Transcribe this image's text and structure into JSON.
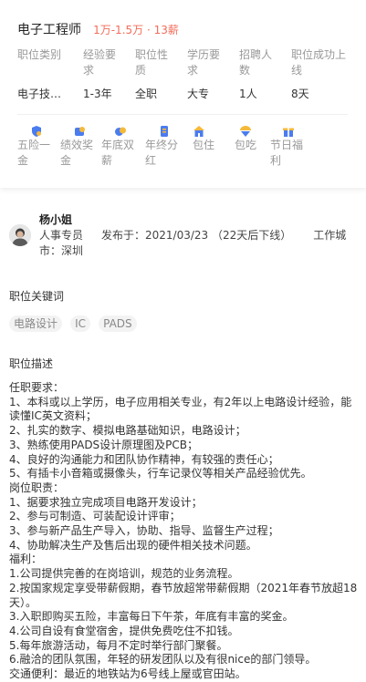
{
  "job": {
    "title": "电子工程师",
    "salary": "1万-1.5万 · 13薪",
    "info": [
      {
        "label": "职位类别",
        "value": "电子技…"
      },
      {
        "label": "经验要求",
        "value": "1-3年"
      },
      {
        "label": "职位性质",
        "value": "全职"
      },
      {
        "label": "学历要求",
        "value": "大专"
      },
      {
        "label": "招聘人数",
        "value": "1人"
      },
      {
        "label": "职位成功上线",
        "value": "8天"
      }
    ],
    "benefits": [
      {
        "label": "五险一金",
        "icon": "insurance-icon"
      },
      {
        "label": "绩效奖金",
        "icon": "bonus-icon"
      },
      {
        "label": "年底双薪",
        "icon": "double-pay-icon"
      },
      {
        "label": "年终分红",
        "icon": "dividend-icon"
      },
      {
        "label": "包住",
        "icon": "housing-icon"
      },
      {
        "label": "包吃",
        "icon": "meal-icon"
      },
      {
        "label": "节日福利",
        "icon": "gift-icon"
      }
    ]
  },
  "contact": {
    "name": "杨小姐",
    "role": "人事专员",
    "published": "发布于：2021/03/23 （22天后下线）",
    "location": "工作城市：深圳"
  },
  "keywords_section": {
    "title": "职位关键词",
    "tags": [
      "电路设计",
      "IC",
      "PADS"
    ]
  },
  "description": {
    "title": "职位描述",
    "lines": [
      "任职要求：",
      "1、本科或以上学历，电子应用相关专业，有2年以上电路设计经验，能读懂IC英文资料；",
      "2、扎实的数字、模拟电路基础知识，电路设计；",
      "3、熟练使用PADS设计原理图及PCB；",
      "4、良好的沟通能力和团队协作精神，有较强的责任心；",
      "5、有插卡小音箱或摄像头，行车记录仪等相关产品经验优先。",
      "岗位职责：",
      "1、据要求独立完成项目电路开发设计；",
      "2、参与可制造、可装配设计评审；",
      "3、参与新产品生产导入，协助、指导、监督生产过程；",
      "4、协助解决生产及售后出现的硬件相关技术问题。",
      "福利：",
      "1.公司提供完善的在岗培训，规范的业务流程。",
      "2.按国家规定享受带薪假期，春节放超常带薪假期（2021年春节放超18天）。",
      "3.入职即购买五险，丰富每日下午茶，年底有丰富的奖金。",
      "4.公司自设有食堂宿舍，提供免费吃住不扣钱。",
      "5.每年旅游活动，每月不定时举行部门聚餐。",
      "6.融洽的团队氛围，年轻的研发团队以及有很nice的部门领导。",
      "交通便利：最近的地铁站为6号线上屋或官田站。"
    ]
  }
}
